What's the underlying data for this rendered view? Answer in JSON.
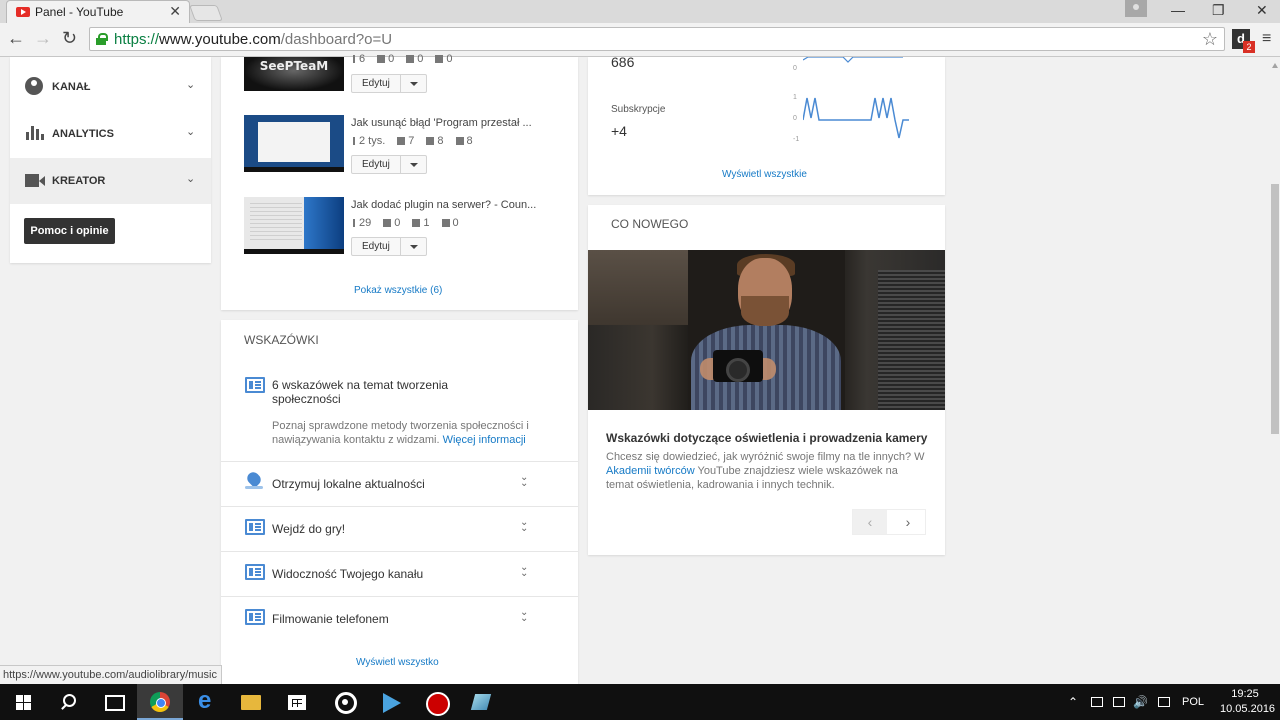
{
  "browser": {
    "tab_title": "Panel - YouTube",
    "tab_close": "✕",
    "url_scheme": "https://",
    "url_host": "www.youtube.com",
    "url_path": "/dashboard?o=U",
    "back": "←",
    "forward": "→",
    "reload": "↻",
    "star": "☆",
    "menu": "≡",
    "extension_letter": "d",
    "extension_badge": "2",
    "win_minimize": "—",
    "win_restore": "❐",
    "win_close": "✕"
  },
  "sidebar": {
    "items": [
      {
        "label": "KANAŁ",
        "icon": "user-icon"
      },
      {
        "label": "ANALYTICS",
        "icon": "bar-chart-icon"
      },
      {
        "label": "KREATOR",
        "icon": "video-camera-icon"
      }
    ],
    "chevron": "⌄",
    "help_button": "Pomoc i opinie"
  },
  "videos": {
    "items": [
      {
        "thumb_text": "SeePTeaM",
        "views": "6",
        "comments": "0",
        "likes": "0",
        "dislikes": "0"
      },
      {
        "title": "Jak usunąć błąd 'Program przestał ...",
        "views": "2 tys.",
        "comments": "7",
        "likes": "8",
        "dislikes": "8"
      },
      {
        "title": "Jak dodać plugin na serwer? - Coun...",
        "views": "29",
        "comments": "0",
        "likes": "1",
        "dislikes": "0"
      }
    ],
    "edit_label": "Edytuj",
    "show_all": "Pokaż wszystkie (6)"
  },
  "tips": {
    "title": "WSKAZÓWKI",
    "featured_title": "6 wskazówek na temat tworzenia społeczności",
    "featured_desc": "Poznaj sprawdzone metody tworzenia społeczności i nawiązywania kontaktu z widzami.",
    "featured_link": "Więcej informacji",
    "rows": [
      {
        "title": "Otrzymuj lokalne aktualności",
        "icon": "location-pin-icon"
      },
      {
        "title": "Wejdź do gry!",
        "icon": "tips-icon"
      },
      {
        "title": "Widoczność Twojego kanału",
        "icon": "tips-icon"
      },
      {
        "title": "Filmowanie telefonem",
        "icon": "tips-icon"
      }
    ],
    "expand": "⌄",
    "footer_link": "Wyświetl wszystko"
  },
  "analytics": {
    "top_value": "686",
    "subs_label": "Subskrypcje",
    "subs_value": "+4",
    "axis_top": "0",
    "axis_labels": [
      "1",
      "0",
      "-1"
    ],
    "view_all": "Wyświetl wszystkie",
    "line_color": "#4a8ad3"
  },
  "news": {
    "title": "CO NOWEGO",
    "headline": "Wskazówki dotyczące oświetlenia i prowadzenia kamery",
    "desc_before": "Chcesz się dowiedzieć, jak wyróżnić swoje filmy na tle innych? W ",
    "desc_link": "Akademii twórców",
    "desc_after": " YouTube znajdziesz wiele wskazówek na temat oświetlenia, kadrowania i innych technik.",
    "prev": "‹",
    "next": "›"
  },
  "status_url": "https://www.youtube.com/audiolibrary/music",
  "taskbar": {
    "language": "POL",
    "time": "19:25",
    "date": "10.05.2016",
    "tray_chevron": "⌃",
    "volume": "🔊"
  }
}
